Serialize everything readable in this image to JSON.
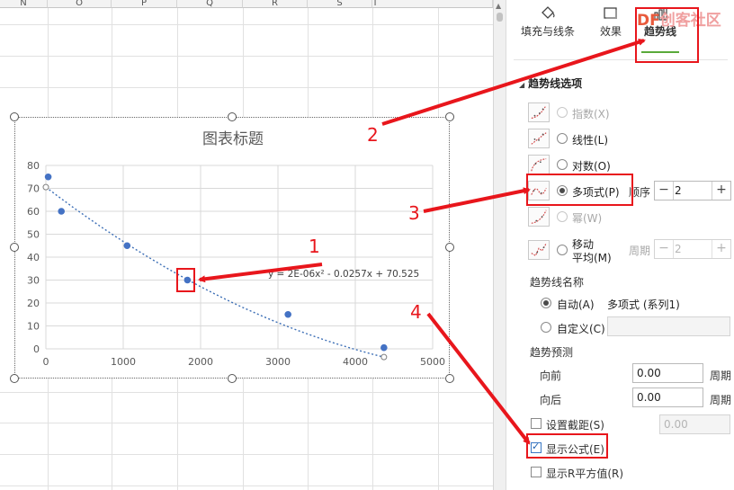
{
  "sheet": {
    "columns": [
      "N",
      "O",
      "P",
      "Q",
      "R",
      "S",
      "T"
    ]
  },
  "chart": {
    "title": "图表标题",
    "trendline_label": "y = 2E-06x² - 0.0257x + 70.525"
  },
  "chart_data": {
    "type": "scatter",
    "title": "图表标题",
    "xlim": [
      0,
      5000
    ],
    "ylim": [
      0,
      80
    ],
    "x_ticks": [
      0,
      1000,
      2000,
      3000,
      4000,
      5000
    ],
    "y_ticks": [
      0,
      10,
      20,
      30,
      40,
      50,
      60,
      70,
      80
    ],
    "grid": true,
    "series": [
      {
        "points": [
          [
            30,
            75
          ],
          [
            200,
            60
          ],
          [
            1050,
            45
          ],
          [
            1830,
            30
          ],
          [
            3130,
            15
          ],
          [
            4370,
            0.5
          ]
        ]
      }
    ],
    "trendline": {
      "type": "polynomial",
      "order": 2,
      "coefficients": [
        2e-06,
        -0.0257,
        70.525
      ],
      "equation": "y = 2E-06x² - 0.0257x + 70.525",
      "color": "#3d6fb6"
    },
    "marker_color": "#4472c4"
  },
  "panel": {
    "tabs": [
      {
        "label": "填充与线条",
        "icon": "paint-bucket-icon"
      },
      {
        "label": "效果",
        "icon": "effects-icon"
      },
      {
        "label": "趋势线",
        "icon": "trendline-icon"
      }
    ],
    "section_title": "趋势线选项",
    "options": [
      {
        "label": "指数(X)",
        "enabled": false,
        "selected": false
      },
      {
        "label": "线性(L)",
        "enabled": true,
        "selected": false
      },
      {
        "label": "对数(O)",
        "enabled": true,
        "selected": false
      },
      {
        "label": "多项式(P)",
        "enabled": true,
        "selected": true
      },
      {
        "label": "幂(W)",
        "enabled": false,
        "selected": false
      },
      {
        "label": "移动",
        "label2": "平均(M)",
        "enabled": true,
        "selected": false
      }
    ],
    "order_label": "顺序",
    "order_value": "2",
    "period_label": "周期",
    "period_value": "2",
    "name_section": "趋势线名称",
    "auto_label": "自动(A)",
    "auto_value": "多项式 (系列1)",
    "custom_label": "自定义(C)",
    "forecast_section": "趋势预测",
    "forward_label": "向前",
    "forward_value": "0.00",
    "backward_label": "向后",
    "backward_value": "0.00",
    "unit_label": "周期",
    "intercept_label": "设置截距(S)",
    "intercept_value": "0.00",
    "show_equation_label": "显示公式(E)",
    "show_equation_checked": true,
    "show_r2_label": "显示R平方值(R)",
    "show_r2_checked": false
  },
  "annotations": {
    "numbers": [
      "1",
      "2",
      "3",
      "4"
    ],
    "color": "#e8161c"
  },
  "watermark": {
    "text_a": "DF",
    "text_b": "创客社区"
  }
}
